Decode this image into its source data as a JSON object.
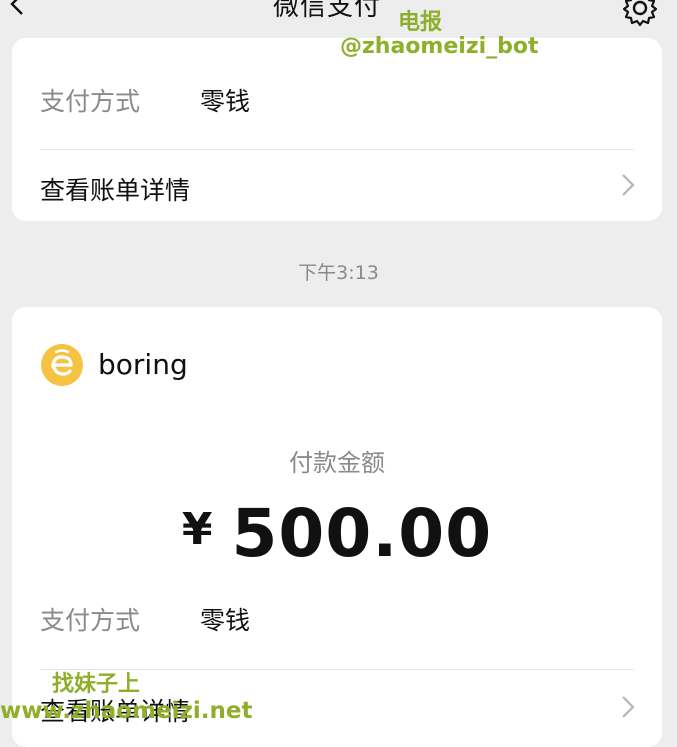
{
  "header": {
    "title": "微信支付"
  },
  "card1": {
    "pay_method_label": "支付方式",
    "pay_method_value": "零钱",
    "details_link": "查看账单详情"
  },
  "time": "下午3:13",
  "card2": {
    "merchant_name": "boring",
    "amount_label": "付款金额",
    "currency_symbol": "¥",
    "amount_value": "500.00",
    "pay_method_label": "支付方式",
    "pay_method_value": "零钱",
    "details_link": "查看账单详情"
  },
  "watermarks": {
    "line1": "电报",
    "line2": "@zhaomeizi_bot",
    "line3": "找妹子上",
    "line4": "www.zhaomeizi.net"
  },
  "colors": {
    "background": "#ededed",
    "card": "#ffffff",
    "muted_text": "#8a8a8a",
    "watermark": "#8fae2a",
    "merchant_logo": "#f5c242"
  },
  "icons": {
    "back": "chevron-left-icon",
    "settings": "gear-icon",
    "row_arrow": "chevron-right-icon",
    "merchant": "merchant-logo-icon"
  }
}
